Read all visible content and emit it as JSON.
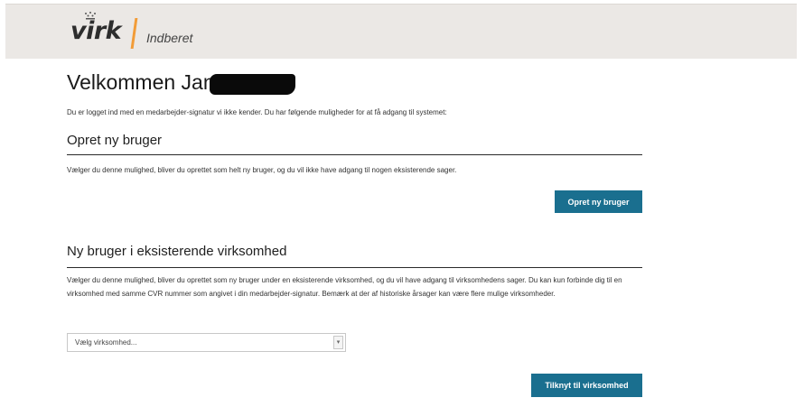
{
  "header": {
    "logo_text": "virk",
    "logo_sub": "Indberet",
    "brand_accent": "#f29c38"
  },
  "main": {
    "title": "Velkommen Jan",
    "intro": "Du er logget ind med en medarbejder-signatur vi ikke kender. Du har følgende muligheder for at få adgang til systemet:",
    "section1": {
      "title": "Opret ny bruger",
      "text": "Vælger du denne mulighed, bliver du oprettet som helt ny bruger, og du vil ikke have adgang til nogen eksisterende sager.",
      "button": "Opret ny bruger"
    },
    "section2": {
      "title": "Ny bruger i eksisterende virksomhed",
      "text": "Vælger du denne mulighed, bliver du oprettet som ny bruger under en eksisterende virksomhed, og du vil have adgang til virksomhedens sager. Du kan kun forbinde dig til en virksomhed med samme CVR nummer som angivet i din medarbejder-signatur. Bemærk at der af historiske årsager kan være flere mulige virksomheder.",
      "select_value": "Vælg virksomhed...",
      "button": "Tilknyt til virksomhed"
    }
  },
  "colors": {
    "button": "#1a6f8f",
    "header_bg": "#ebe8e5"
  }
}
